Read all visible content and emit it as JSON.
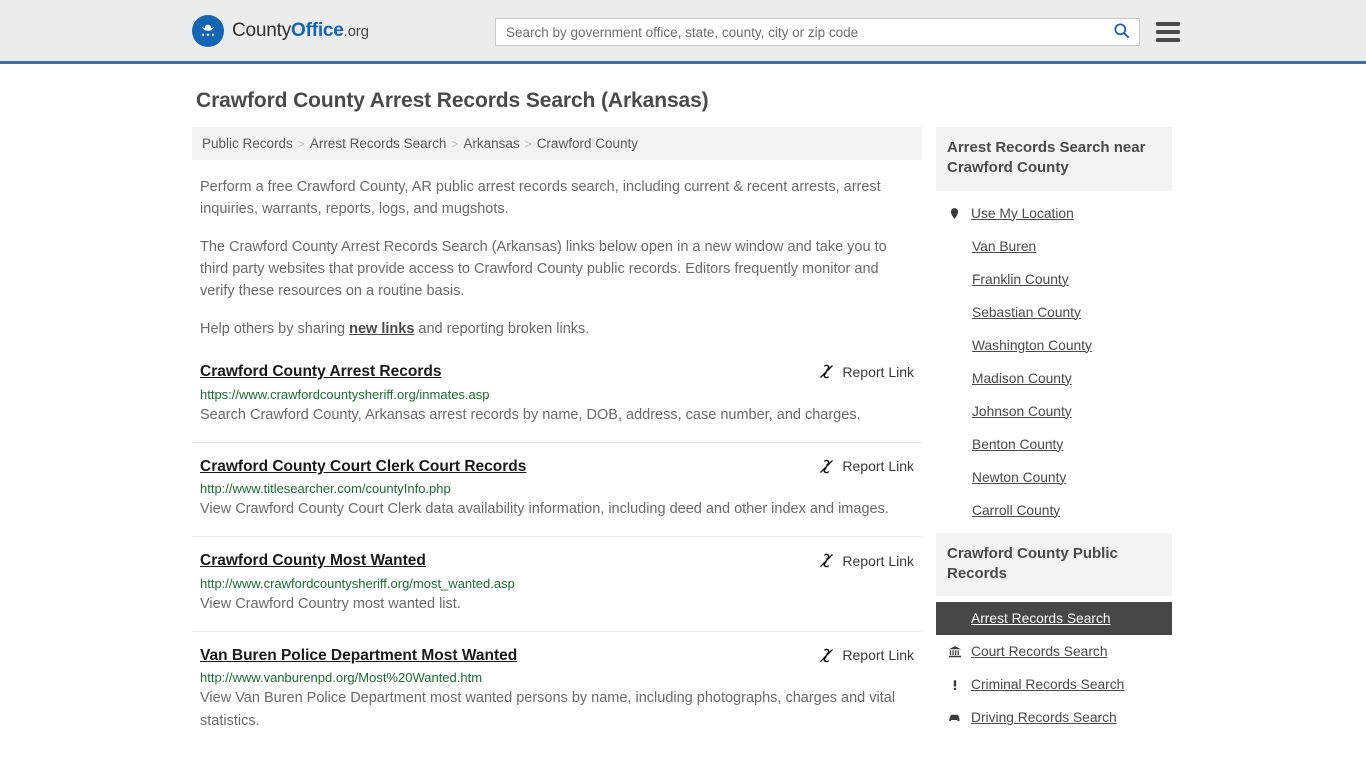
{
  "header": {
    "logo": {
      "icon": "eagle-seal-icon",
      "part1": "County",
      "part2": "Office",
      "part3": ".org"
    },
    "search": {
      "placeholder": "Search by government office, state, county, city or zip code",
      "value": "",
      "button_icon": "search-icon"
    },
    "menu_icon": "hamburger-menu-icon",
    "accent_color": "#3d6f9e"
  },
  "page": {
    "title": "Crawford County Arrest Records Search (Arkansas)"
  },
  "breadcrumb": {
    "separator": ">",
    "items": [
      {
        "label": "Public Records"
      },
      {
        "label": "Arrest Records Search"
      },
      {
        "label": "Arkansas"
      },
      {
        "label": "Crawford County"
      }
    ]
  },
  "intro": {
    "p1": "Perform a free Crawford County, AR public arrest records search, including current & recent arrests, arrest inquiries, warrants, reports, logs, and mugshots.",
    "p2": "The Crawford County Arrest Records Search (Arkansas) links below open in a new window and take you to third party websites that provide access to Crawford County public records. Editors frequently monitor and verify these resources on a routine basis.",
    "p3_before": "Help others by sharing ",
    "p3_link": "new links",
    "p3_after": " and reporting broken links."
  },
  "results": {
    "report_label": "Report Link",
    "report_icon": "broken-link-icon",
    "items": [
      {
        "title": "Crawford County Arrest Records",
        "url": "https://www.crawfordcountysheriff.org/inmates.asp",
        "desc": "Search Crawford County, Arkansas arrest records by name, DOB, address, case number, and charges."
      },
      {
        "title": "Crawford County Court Clerk Court Records",
        "url": "http://www.titlesearcher.com/countyInfo.php",
        "desc": "View Crawford County Court Clerk data availability information, including deed and other index and images."
      },
      {
        "title": "Crawford County Most Wanted",
        "url": "http://www.crawfordcountysheriff.org/most_wanted.asp",
        "desc": "View Crawford Country most wanted list."
      },
      {
        "title": "Van Buren Police Department Most Wanted",
        "url": "http://www.vanburenpd.org/Most%20Wanted.htm",
        "desc": "View Van Buren Police Department most wanted persons by name, including photographs, charges and vital statistics."
      }
    ]
  },
  "sidebar": {
    "nearby_panel": {
      "title": "Arrest Records Search near Crawford County",
      "items": [
        {
          "label": "Use My Location",
          "icon": "map-pin-icon",
          "has_icon": true
        },
        {
          "label": "Van Buren",
          "icon": "",
          "has_icon": false
        },
        {
          "label": "Franklin County",
          "icon": "",
          "has_icon": false
        },
        {
          "label": "Sebastian County",
          "icon": "",
          "has_icon": false
        },
        {
          "label": "Washington County",
          "icon": "",
          "has_icon": false
        },
        {
          "label": "Madison County",
          "icon": "",
          "has_icon": false
        },
        {
          "label": "Johnson County",
          "icon": "",
          "has_icon": false
        },
        {
          "label": "Benton County",
          "icon": "",
          "has_icon": false
        },
        {
          "label": "Newton County",
          "icon": "",
          "has_icon": false
        },
        {
          "label": "Carroll County",
          "icon": "",
          "has_icon": false
        }
      ]
    },
    "records_panel": {
      "title": "Crawford County Public Records",
      "items": [
        {
          "label": "Arrest Records Search",
          "icon": "file-square-icon",
          "active": true
        },
        {
          "label": "Court Records Search",
          "icon": "courthouse-icon",
          "active": false
        },
        {
          "label": "Criminal Records Search",
          "icon": "exclamation-icon",
          "active": false
        },
        {
          "label": "Driving Records Search",
          "icon": "car-icon",
          "active": false
        }
      ],
      "active_bg": "#474747"
    }
  }
}
